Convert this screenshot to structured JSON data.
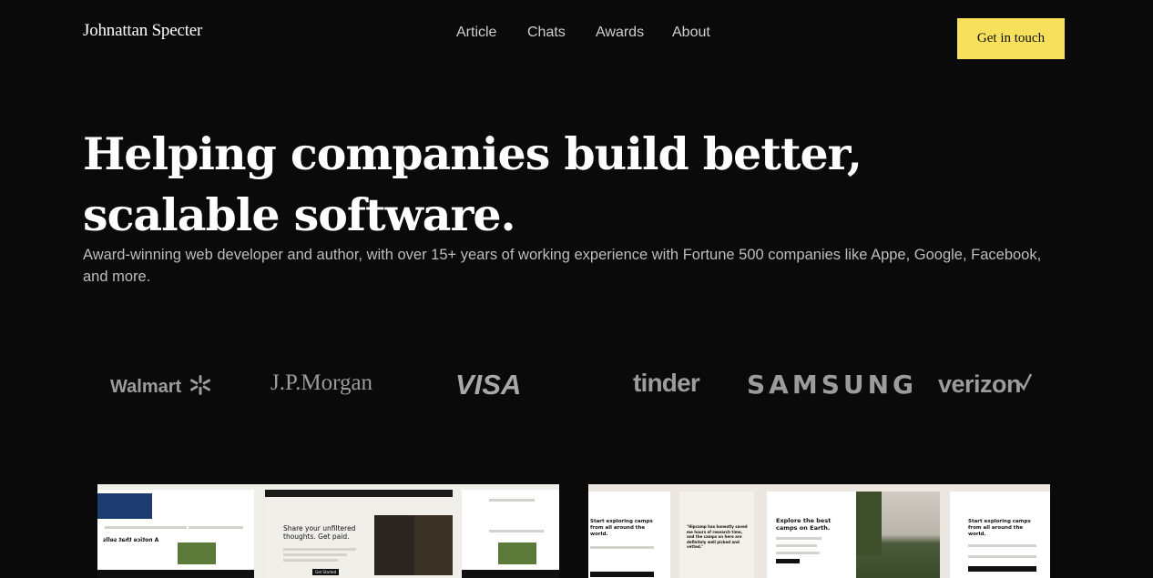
{
  "header": {
    "brand": "Johnattan Specter",
    "nav": [
      {
        "label": "Article"
      },
      {
        "label": "Chats"
      },
      {
        "label": "Awards"
      },
      {
        "label": "About"
      }
    ],
    "cta_label": "Get in touch",
    "cta_color": "#f7e15c"
  },
  "hero": {
    "title": "Helping companies build better, scalable software.",
    "subtitle": "Award-winning web developer and author, with over 15+ years of working experience with Fortune 500 companies like Appe, Google, Facebook, and more."
  },
  "clients": [
    {
      "name": "Walmart",
      "icon": "walmart-spark-icon"
    },
    {
      "name": "J.P.Morgan"
    },
    {
      "name": "VISA"
    },
    {
      "name": "tinder"
    },
    {
      "name": "SAMSUNG"
    },
    {
      "name": "verizon",
      "icon": "check-icon"
    }
  ],
  "projects": {
    "left": {
      "headline": "Share your unfiltered thoughts. Get paid.",
      "side_left": "A notice that sells",
      "side_button": "Get Started"
    },
    "right": {
      "headline_a": "Start exploring camps from all around the world.",
      "quote": "\"Hipcamp has honestly saved me hours of research time, and the camps on here are definitely well picked and vetted.\"",
      "headline_b": "Explore the best camps on Earth.",
      "headline_c": "Start exploring camps from all around the world."
    }
  }
}
